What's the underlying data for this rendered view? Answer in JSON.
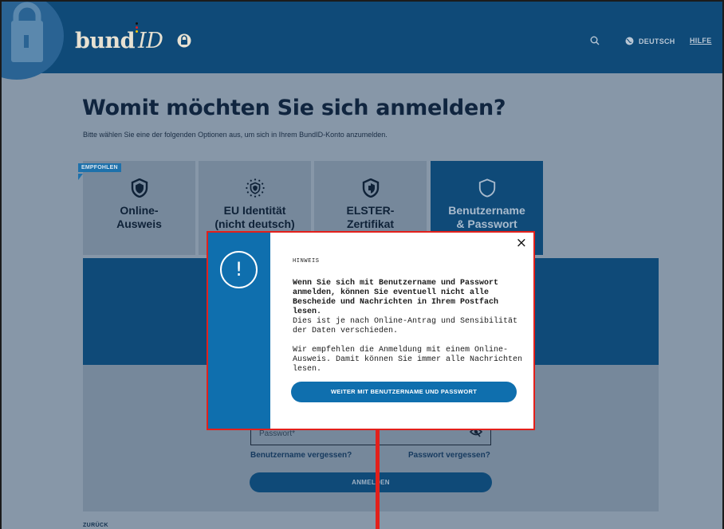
{
  "header": {
    "logo_text": "bund",
    "logo_id": "ID",
    "language_label": "DEUTSCH",
    "help_label": "HILFE",
    "icons": [
      "lock-icon",
      "search-icon",
      "globe-icon"
    ]
  },
  "page": {
    "title": "Womit möchten Sie sich anmelden?",
    "subtitle": "Bitte wählen Sie eine der folgenden Optionen aus, um sich in Ihrem BundID-Konto anzumelden.",
    "badge": "EMPFOHLEN",
    "options": [
      {
        "line1": "Online-",
        "line2": "Ausweis",
        "icon": "shield-icon"
      },
      {
        "line1": "EU Identität",
        "line2": "(nicht deutsch)",
        "icon": "eu-shield-icon"
      },
      {
        "line1": "ELSTER-",
        "line2": "Zertifikat",
        "icon": "shield-key-icon"
      },
      {
        "line1": "Benutzername",
        "line2": "& Passwort",
        "icon": "shield-outline-icon"
      }
    ],
    "password_placeholder": "Passwort*",
    "forgot_username": "Benutzername vergessen?",
    "forgot_password": "Passwort vergessen?",
    "login_button": "ANMELDEN",
    "back_link": "ZURÜCK"
  },
  "modal": {
    "label": "HINWEIS",
    "bold_text": "Wenn Sie sich mit Benutzername und Passwort anmelden, können Sie eventuell nicht alle Bescheide und Nachrichten in Ihrem Postfach lesen.",
    "text1": "Dies ist je nach Online-Antrag und Sensibilität der Daten verschieden.",
    "text2": "Wir empfehlen die Anmeldung mit einem Online-Ausweis. Damit können Sie immer alle Nachrichten lesen.",
    "button": "WEITER MIT BENUTZERNAME UND PASSWORT",
    "close": "×",
    "icon_glyph": "!"
  },
  "colors": {
    "header_bg": "#0f4a78",
    "overlay_bg": "#8797a8",
    "accent": "#0f6fae",
    "highlight": "#e3201b"
  }
}
